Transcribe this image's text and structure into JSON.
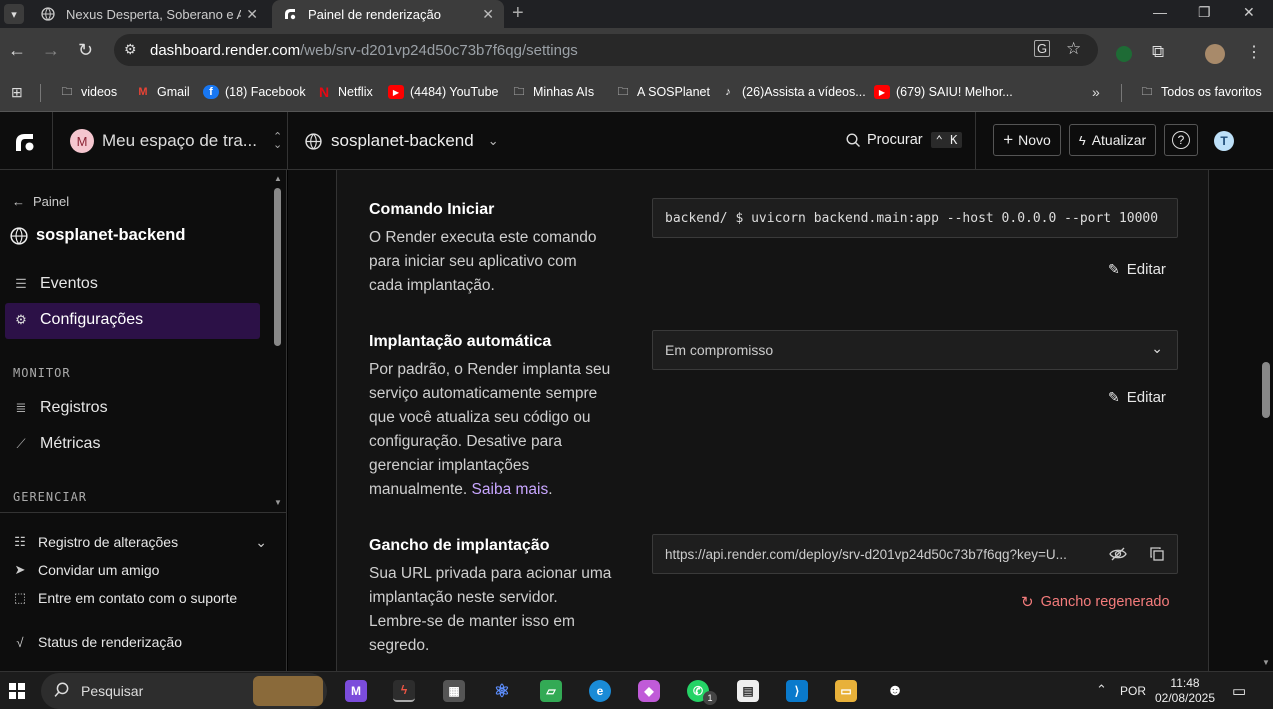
{
  "browser": {
    "tabs": [
      {
        "title": "Nexus Desperta, Soberano e Au",
        "active": false
      },
      {
        "title": "Painel de renderização",
        "active": true
      }
    ],
    "url_host": "dashboard.render.com",
    "url_path": "/web/srv-d201vp24d50c73b7f6qg/settings",
    "bookmarks": [
      {
        "label": "videos",
        "icon": "folder-icon"
      },
      {
        "label": "Gmail",
        "icon": "gmail-icon"
      },
      {
        "label": "(18) Facebook",
        "icon": "facebook-icon"
      },
      {
        "label": "Netflix",
        "icon": "netflix-icon"
      },
      {
        "label": "(4484) YouTube",
        "icon": "youtube-icon"
      },
      {
        "label": "Minhas AIs",
        "icon": "folder-icon"
      },
      {
        "label": "A SOSPlanet",
        "icon": "folder-icon"
      },
      {
        "label": "(26)Assista a vídeos...",
        "icon": "tiktok-icon"
      },
      {
        "label": "(679) SAIU! Melhor...",
        "icon": "youtube-icon"
      }
    ],
    "all_bookmarks": "Todos os favoritos"
  },
  "header": {
    "workspace_initial": "M",
    "workspace": "Meu espaço de tra...",
    "service": "sosplanet-backend",
    "search": "Procurar",
    "search_shortcut": "K",
    "new_label": "Novo",
    "upgrade_label": "Atualizar",
    "help": "?",
    "avatar": "T"
  },
  "sidebar": {
    "back": "Painel",
    "service": "sosplanet-backend",
    "items": [
      {
        "label": "Eventos",
        "active": false
      },
      {
        "label": "Configurações",
        "active": true
      }
    ],
    "monitor_heading": "MONITOR",
    "monitor_items": [
      {
        "label": "Registros"
      },
      {
        "label": "Métricas"
      }
    ],
    "manage_heading": "GERENCIAR",
    "footer": [
      {
        "label": "Registro de alterações"
      },
      {
        "label": "Convidar um amigo"
      },
      {
        "label": "Entre em contato com o suporte"
      },
      {
        "label": "Status de renderização"
      }
    ]
  },
  "settings": {
    "start_command": {
      "title": "Comando Iniciar",
      "desc": "O Render executa este comando para iniciar seu aplicativo com cada implantação.",
      "value": "backend/ $ uvicorn backend.main:app --host 0.0.0.0 --port 10000",
      "edit": "Editar"
    },
    "auto_deploy": {
      "title": "Implantação automática",
      "desc": "Por padrão, o Render implanta seu serviço automaticamente sempre que você atualiza seu código ou configuração. Desative para gerenciar implantações manualmente.",
      "link": "Saiba mais",
      "value": "Em compromisso",
      "edit": "Editar"
    },
    "deploy_hook": {
      "title": "Gancho de implantação",
      "desc": "Sua URL privada para acionar uma implantação neste servidor. Lembre-se de manter isso em segredo.",
      "value": "https://api.render.com/deploy/srv-d201vp24d50c73b7f6qg?key=U...",
      "regenerate": "Gancho regenerado"
    }
  },
  "taskbar": {
    "search": "Pesquisar",
    "lang": "POR",
    "time": "11:48",
    "date": "02/08/2025",
    "whatsapp_badge": "1"
  },
  "colors": {
    "accent_purple": "#2c1147",
    "link": "#c8a6ff",
    "regenerate": "#f47c7c"
  }
}
